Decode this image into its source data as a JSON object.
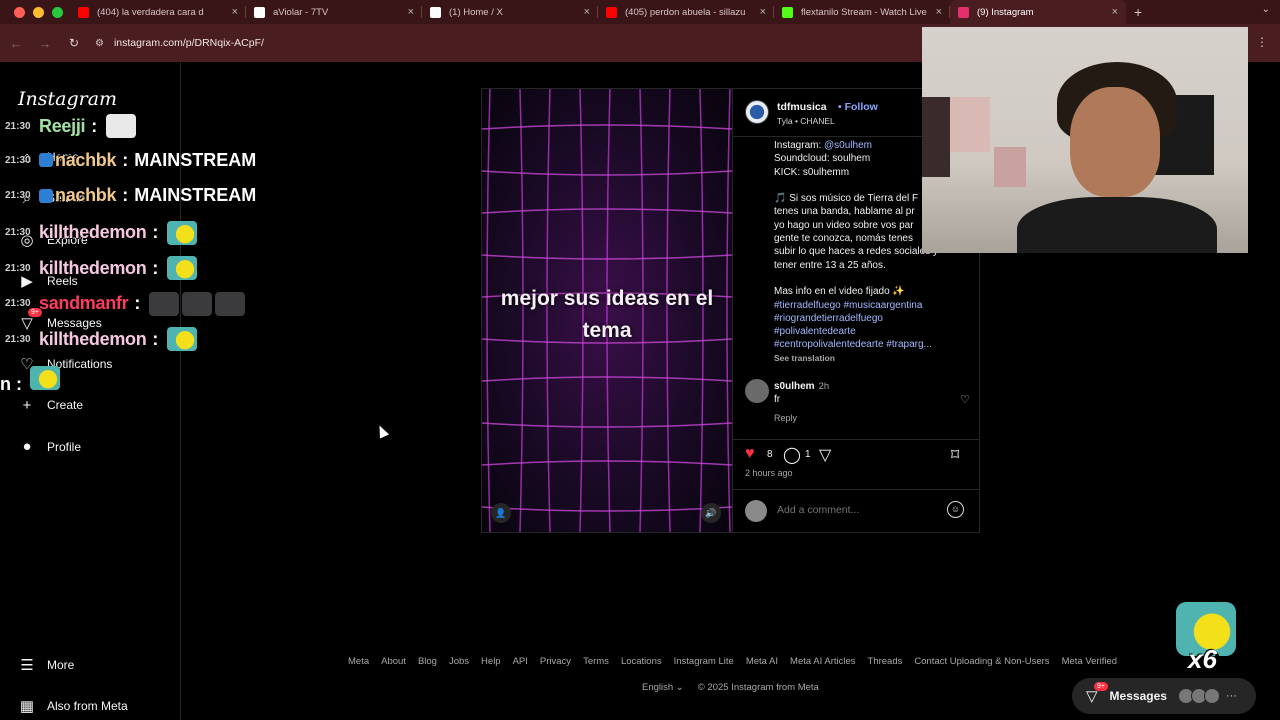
{
  "browser": {
    "tabs": [
      {
        "title": "(404) la verdadera cara d",
        "icon": "youtube-icon",
        "color": "#ff0000"
      },
      {
        "title": "aViolar - 7TV",
        "icon": "7tv-icon",
        "color": "#ffffff"
      },
      {
        "title": "(1) Home / X",
        "icon": "x-icon",
        "color": "#ffffff"
      },
      {
        "title": "(405) perdon abuela - sillazu",
        "icon": "youtube-icon",
        "color": "#ff0000"
      },
      {
        "title": "flextanilo Stream - Watch Live",
        "icon": "kick-icon",
        "color": "#53fc18"
      },
      {
        "title": "(9) Instagram",
        "icon": "instagram-icon",
        "color": "#e1306c"
      }
    ],
    "url": "instagram.com/p/DRNqix-ACpF/"
  },
  "sidebar": {
    "logo": "Instagram",
    "items": [
      {
        "label": "Home",
        "icon": "home-icon"
      },
      {
        "label": "Search",
        "icon": "search-icon"
      },
      {
        "label": "Explore",
        "icon": "compass-icon"
      },
      {
        "label": "Reels",
        "icon": "reels-icon"
      },
      {
        "label": "Messages",
        "icon": "messenger-icon",
        "badge": "9+"
      },
      {
        "label": "Notifications",
        "icon": "heart-icon"
      },
      {
        "label": "Create",
        "icon": "plus-icon"
      },
      {
        "label": "Profile",
        "icon": "profile-icon"
      }
    ],
    "more": "More",
    "also_from_meta": "Also from Meta"
  },
  "chat": [
    {
      "time": "21:30",
      "user": "Reejji",
      "color": "#9fe3a0",
      "msg": ""
    },
    {
      "time": "21:30",
      "user": "nachbk",
      "color": "#f0c987",
      "msg": "MAINSTREAM"
    },
    {
      "time": "21:30",
      "user": "nachbk",
      "color": "#f0c987",
      "msg": "MAINSTREAM"
    },
    {
      "time": "21:30",
      "user": "killthedemon",
      "color": "#f5c8e0",
      "msg": ""
    },
    {
      "time": "21:30",
      "user": "killthedemon",
      "color": "#f5c8e0",
      "msg": ""
    },
    {
      "time": "21:30",
      "user": "sandmanfr",
      "color": "#ff3b5c",
      "msg": ""
    },
    {
      "time": "21:30",
      "user": "killthedemon",
      "color": "#f5c8e0",
      "msg": ""
    }
  ],
  "chat_partial": "n :",
  "post": {
    "media_text": "mejor sus ideas en el tema",
    "username": "tdfmusica",
    "follow": "Follow",
    "music_artist": "Tyla",
    "music_track": "CHANEL",
    "caption_lines": [
      {
        "text": "Instagram: ",
        "link": "@s0ulhem"
      },
      {
        "text": "Soundcloud: soulhem",
        "link": ""
      },
      {
        "text": "KICK: s0ulhemm",
        "link": ""
      },
      {
        "text": "",
        "link": ""
      },
      {
        "text": "🎵 Si sos músico de Tierra del F",
        "link": ""
      },
      {
        "text": "tenes una banda, hablame al pr",
        "link": ""
      },
      {
        "text": "yo hago un video sobre vos par",
        "link": ""
      },
      {
        "text": "gente te conozca, nomás tenes",
        "link": ""
      },
      {
        "text": "subir lo que haces a redes sociales y",
        "link": ""
      },
      {
        "text": "tener entre 13 a 25 años.",
        "link": ""
      },
      {
        "text": "",
        "link": ""
      },
      {
        "text": "Mas info en el video fijado ✨",
        "link": ""
      },
      {
        "text": "",
        "link": "#tierradelfuego #musicaargentina"
      },
      {
        "text": "",
        "link": "#riograndetierradelfuego"
      },
      {
        "text": "",
        "link": "#polivalentedearte"
      },
      {
        "text": "",
        "link": "#centropolivalentedearte #traparg..."
      }
    ],
    "see_translation": "See translation",
    "comment": {
      "user": "s0ulhem",
      "time": "2h",
      "text": "fr",
      "reply": "Reply"
    },
    "likes": "8",
    "comments": "1",
    "age": "2 hours ago",
    "add_comment_placeholder": "Add a comment..."
  },
  "footer": {
    "links": [
      "Meta",
      "About",
      "Blog",
      "Jobs",
      "Help",
      "API",
      "Privacy",
      "Terms",
      "Locations",
      "Instagram Lite",
      "Meta AI",
      "Meta AI Articles",
      "Threads",
      "Contact Uploading & Non-Users",
      "Meta Verified"
    ],
    "language": "English",
    "copyright": "© 2025 Instagram from Meta"
  },
  "messages_pill": {
    "label": "Messages",
    "badge": "9+"
  },
  "overlay_emote_count": "x6"
}
